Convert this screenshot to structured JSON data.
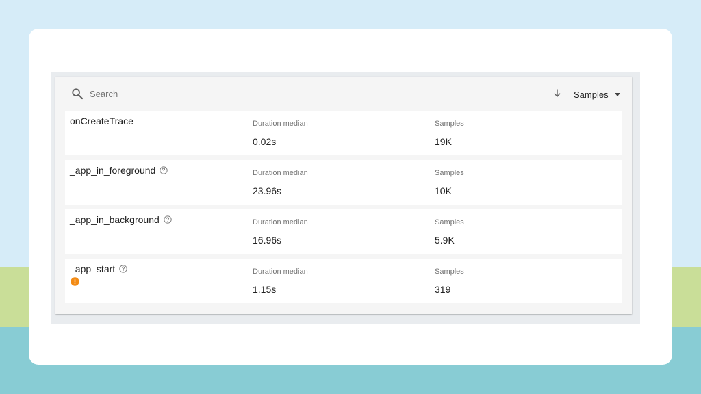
{
  "toolbar": {
    "search_placeholder": "Search",
    "sort_label": "Samples"
  },
  "columns": {
    "duration_label": "Duration median",
    "samples_label": "Samples"
  },
  "traces": [
    {
      "name": "onCreateTrace",
      "duration_median": "0.02s",
      "samples": "19K",
      "has_help": false,
      "has_warning": false
    },
    {
      "name": "_app_in_foreground",
      "duration_median": "23.96s",
      "samples": "10K",
      "has_help": true,
      "has_warning": false
    },
    {
      "name": "_app_in_background",
      "duration_median": "16.96s",
      "samples": "5.9K",
      "has_help": true,
      "has_warning": false
    },
    {
      "name": "_app_start",
      "duration_median": "1.15s",
      "samples": "319",
      "has_help": true,
      "has_warning": true
    }
  ],
  "colors": {
    "warning": "#f38b14",
    "help": "#757575"
  }
}
